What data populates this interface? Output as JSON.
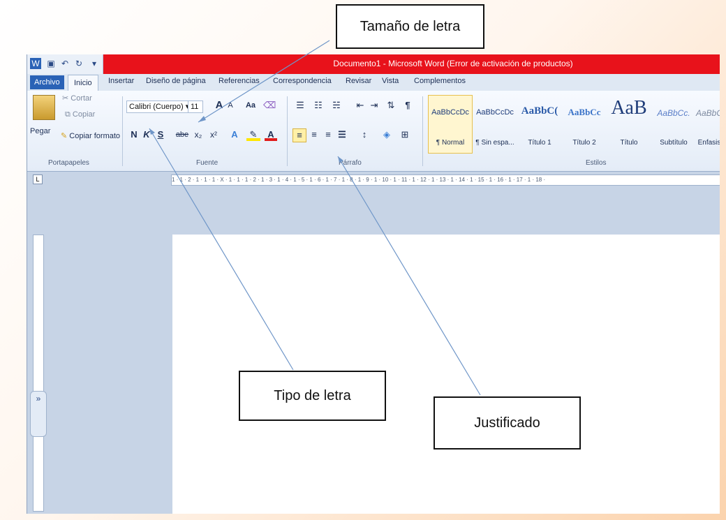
{
  "callouts": {
    "size": "Tamaño de letra",
    "font": "Tipo de letra",
    "justify": "Justificado"
  },
  "window": {
    "title": "Documento1 - Microsoft Word (Error de activación de productos)"
  },
  "tabs": [
    "Archivo",
    "Inicio",
    "Insertar",
    "Diseño de página",
    "Referencias",
    "Correspondencia",
    "Revisar",
    "Vista",
    "Complementos"
  ],
  "clipboard": {
    "paste": "Pegar",
    "cut": "Cortar",
    "copy": "Copiar",
    "format_painter": "Copiar formato",
    "label": "Portapapeles"
  },
  "font": {
    "name": "Calibri (Cuerpo)",
    "size": "11",
    "label": "Fuente",
    "bold": "N",
    "italic": "K",
    "underline": "S",
    "strike": "abe",
    "sub": "x₂",
    "sup": "x²",
    "grow": "A",
    "shrink": "A",
    "case": "Aa"
  },
  "paragraph": {
    "label": "Párrafo"
  },
  "styles": {
    "label": "Estilos",
    "items": [
      {
        "preview": "AaBbCcDc",
        "name": "¶ Normal"
      },
      {
        "preview": "AaBbCcDc",
        "name": "¶ Sin espa..."
      },
      {
        "preview": "AaBbC(",
        "name": "Título 1"
      },
      {
        "preview": "AaBbCc",
        "name": "Título 2"
      },
      {
        "preview": "AaB",
        "name": "Título"
      },
      {
        "preview": "AaBbCc.",
        "name": "Subtítulo"
      },
      {
        "preview": "AaBbC",
        "name": "Énfasis"
      }
    ]
  },
  "ruler": {
    "marks": "1 · 1 · 2 · 1 · 1 · 1 · X · 1 · 1 · 1 · 2 · 1 · 3 · 1 · 4 · 1 · 5 · 1 · 6 · 1 · 7 · 1 · 8 · 1 · 9 · 1 · 10 · 1 · 11 · 1 · 12 · 1 · 13 · 1 · 14 · 1 · 15 · 1 · 16 · 1 · 17 · 1 · 18 ·"
  },
  "colors": {
    "titlebar": "#e8121b",
    "file_tab": "#2a62b6",
    "highlight": "#fff0a8"
  }
}
